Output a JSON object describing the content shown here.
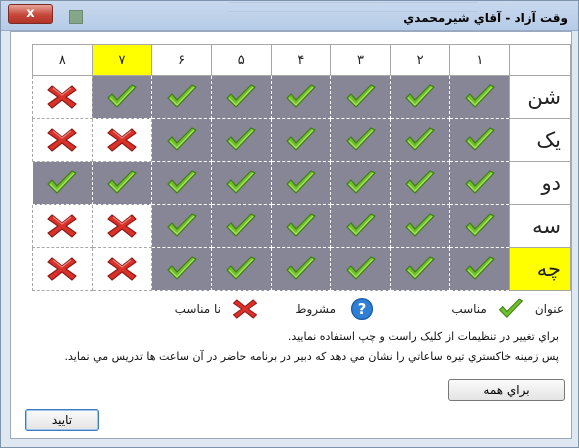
{
  "window": {
    "title": "وقت آزاد - آقاي شيرمحمدي",
    "close_label": "x"
  },
  "grid": {
    "periods": [
      "٨",
      "٧",
      "۶",
      "۵",
      "۴",
      "٣",
      "٢",
      "١"
    ],
    "highlight_period_index": 1,
    "rows": [
      {
        "day": "شن",
        "highlight": false,
        "cells": [
          {
            "status": "no",
            "bg": "white"
          },
          {
            "status": "ok",
            "bg": "gray"
          },
          {
            "status": "ok",
            "bg": "gray"
          },
          {
            "status": "ok",
            "bg": "gray"
          },
          {
            "status": "ok",
            "bg": "gray"
          },
          {
            "status": "ok",
            "bg": "gray"
          },
          {
            "status": "ok",
            "bg": "gray"
          },
          {
            "status": "ok",
            "bg": "gray"
          }
        ]
      },
      {
        "day": "یک",
        "highlight": false,
        "cells": [
          {
            "status": "no",
            "bg": "white"
          },
          {
            "status": "no",
            "bg": "white"
          },
          {
            "status": "ok",
            "bg": "gray"
          },
          {
            "status": "ok",
            "bg": "gray"
          },
          {
            "status": "ok",
            "bg": "gray"
          },
          {
            "status": "ok",
            "bg": "gray"
          },
          {
            "status": "ok",
            "bg": "gray"
          },
          {
            "status": "ok",
            "bg": "gray"
          }
        ]
      },
      {
        "day": "دو",
        "highlight": false,
        "cells": [
          {
            "status": "ok",
            "bg": "gray"
          },
          {
            "status": "ok",
            "bg": "gray"
          },
          {
            "status": "ok",
            "bg": "gray"
          },
          {
            "status": "ok",
            "bg": "gray"
          },
          {
            "status": "ok",
            "bg": "gray"
          },
          {
            "status": "ok",
            "bg": "gray"
          },
          {
            "status": "ok",
            "bg": "gray"
          },
          {
            "status": "ok",
            "bg": "gray"
          }
        ]
      },
      {
        "day": "سه",
        "highlight": false,
        "cells": [
          {
            "status": "no",
            "bg": "white"
          },
          {
            "status": "no",
            "bg": "white"
          },
          {
            "status": "ok",
            "bg": "gray"
          },
          {
            "status": "ok",
            "bg": "gray"
          },
          {
            "status": "ok",
            "bg": "gray"
          },
          {
            "status": "ok",
            "bg": "gray"
          },
          {
            "status": "ok",
            "bg": "gray"
          },
          {
            "status": "ok",
            "bg": "gray"
          }
        ]
      },
      {
        "day": "چه",
        "highlight": true,
        "cells": [
          {
            "status": "no",
            "bg": "white"
          },
          {
            "status": "no",
            "bg": "white"
          },
          {
            "status": "ok",
            "bg": "gray"
          },
          {
            "status": "ok",
            "bg": "gray"
          },
          {
            "status": "ok",
            "bg": "gray"
          },
          {
            "status": "ok",
            "bg": "gray"
          },
          {
            "status": "ok",
            "bg": "gray"
          },
          {
            "status": "ok",
            "bg": "gray"
          }
        ]
      }
    ]
  },
  "legend": {
    "title": "عنوان",
    "suitable": "مناسب",
    "conditional": "مشروط",
    "unsuitable": "نا مناسب"
  },
  "info": {
    "line1": "براي تغيير در تنظيمات از کليک راست و چپ استفاده نماييد.",
    "line2": "پس زمينه خاکستري تيره ساعاتي را نشان مي دهد که دبير در برنامه حاضر در آن ساعت ها تدريس مي نمايد."
  },
  "buttons": {
    "for_all": "براي همه",
    "confirm": "تاييد"
  },
  "colors": {
    "highlight": "#ffff00",
    "busy_gray": "#868696",
    "check_green": "#6fbf2a",
    "cross_red": "#d9302a",
    "question_blue": "#2f7fd6"
  },
  "icons": {
    "ok": "check-icon",
    "no": "cross-icon",
    "conditional": "question-icon"
  }
}
